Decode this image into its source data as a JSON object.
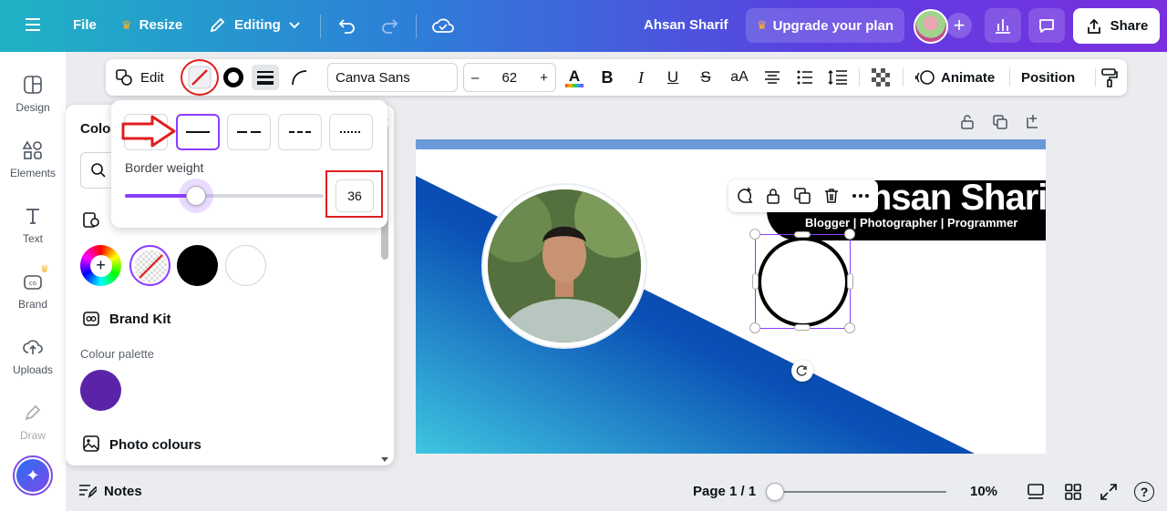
{
  "topbar": {
    "file_label": "File",
    "resize_label": "Resize",
    "editing_label": "Editing",
    "user_name": "Ahsan Sharif",
    "upgrade_label": "Upgrade your plan",
    "share_label": "Share",
    "plus_symbol": "+"
  },
  "rail": {
    "items": [
      {
        "label": "Design"
      },
      {
        "label": "Elements"
      },
      {
        "label": "Text"
      },
      {
        "label": "Brand"
      },
      {
        "label": "Uploads"
      },
      {
        "label": "Draw"
      }
    ]
  },
  "toolbar": {
    "edit_label": "Edit",
    "font_family": "Canva Sans",
    "font_size": "62",
    "minus": "–",
    "plus": "+",
    "bold": "B",
    "italic": "I",
    "underline": "U",
    "strike": "S",
    "case": "aA",
    "animate_label": "Animate",
    "position_label": "Position"
  },
  "panel": {
    "title": "Colour",
    "brand_kit_label": "Brand Kit",
    "colour_palette_label": "Colour palette",
    "photo_colours_label": "Photo colours",
    "palette_color": "#5b24a8",
    "plus": "+"
  },
  "border_popover": {
    "weight_label": "Border weight",
    "weight_value": "36",
    "weight_level": 0.36
  },
  "design": {
    "name_text": "Ahsan Sharif",
    "subtitle": "Blogger | Photographer | Programmer"
  },
  "bottombar": {
    "notes_label": "Notes",
    "page_label": "Page 1 / 1",
    "zoom_label": "10%",
    "help": "?"
  },
  "colors": {
    "accent": "#8b3dff",
    "highlight": "#e01e1e",
    "blue_shape": "#0a4fb5"
  }
}
